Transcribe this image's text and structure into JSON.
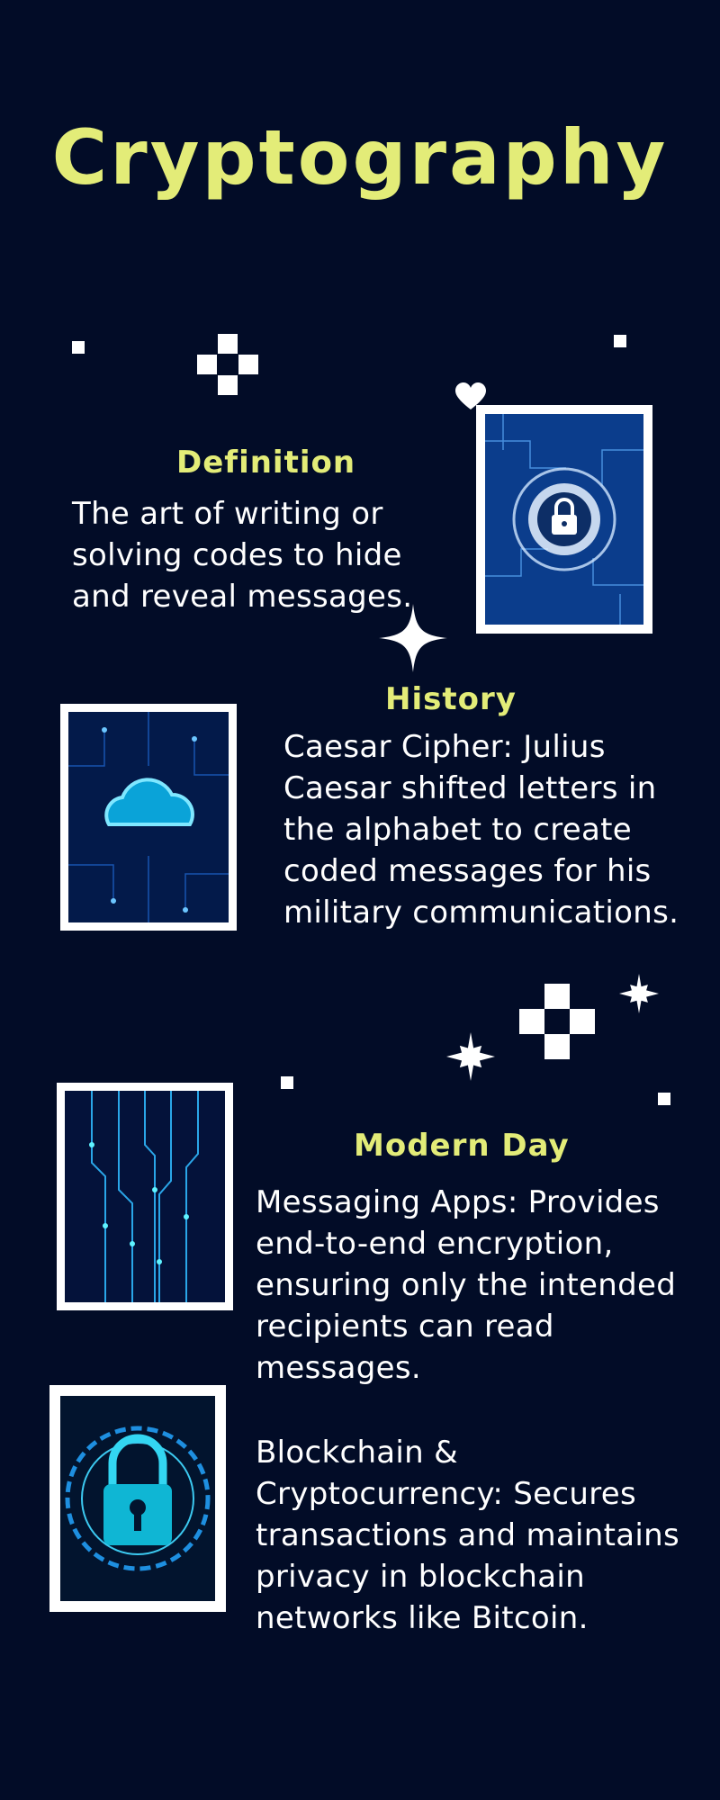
{
  "page": {
    "title": "Cryptography",
    "colors": {
      "background": "#020c27",
      "accent": "#e3ec78",
      "text": "#ffffff"
    }
  },
  "sections": {
    "definition": {
      "heading": "Definition",
      "body": "The art of writing or\nsolving codes to hide\nand reveal messages.",
      "image": "padlock-circuit-image"
    },
    "history": {
      "heading": "History",
      "body": "Caesar Cipher: Julius\nCaesar shifted letters in\nthe alphabet to create\ncoded messages for his\nmilitary communications.",
      "image": "cloud-network-image"
    },
    "modern": {
      "heading": "Modern Day",
      "item1": "Messaging Apps: Provides\nend-to-end encryption,\nensuring only the intended\nrecipients can read\nmessages.",
      "item2": "Blockchain &\nCryptocurrency: Secures\ntransactions and maintains\nprivacy in blockchain\nnetworks like Bitcoin.",
      "images": [
        "circuit-lines-image",
        "digital-lock-image"
      ]
    }
  }
}
